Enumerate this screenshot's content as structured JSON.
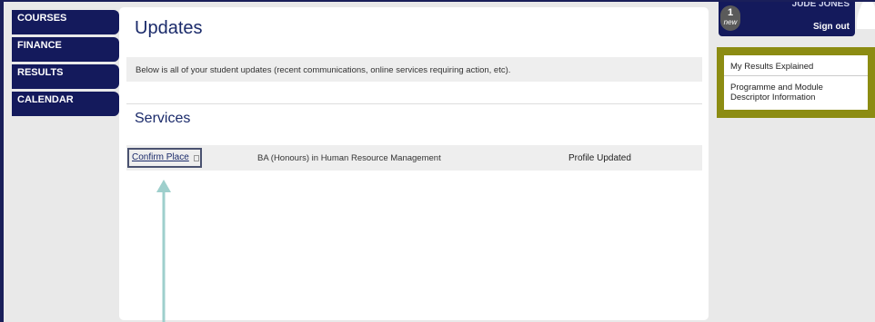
{
  "nav": {
    "items": [
      {
        "label": "COURSES"
      },
      {
        "label": "FINANCE"
      },
      {
        "label": "RESULTS"
      },
      {
        "label": "CALENDAR"
      }
    ]
  },
  "main": {
    "title": "Updates",
    "intro": "Below is all of your student updates (recent communications, online services requiring action, etc).",
    "services_title": "Services",
    "service": {
      "action_label": "Confirm Place",
      "course": "BA (Honours) in Human Resource Management",
      "status": "Profile Updated"
    }
  },
  "user": {
    "name": "JUDE JONES",
    "signout_label": "Sign out",
    "notifications": {
      "count": "1",
      "label": "new"
    }
  },
  "side_links": {
    "results_explained": "My Results Explained",
    "programme_info": "Programme and Module Descriptor Information"
  },
  "colors": {
    "nav_bg": "#141a5c",
    "highlight_olive": "#8c8c12",
    "arrow": "#9ecfcc"
  }
}
